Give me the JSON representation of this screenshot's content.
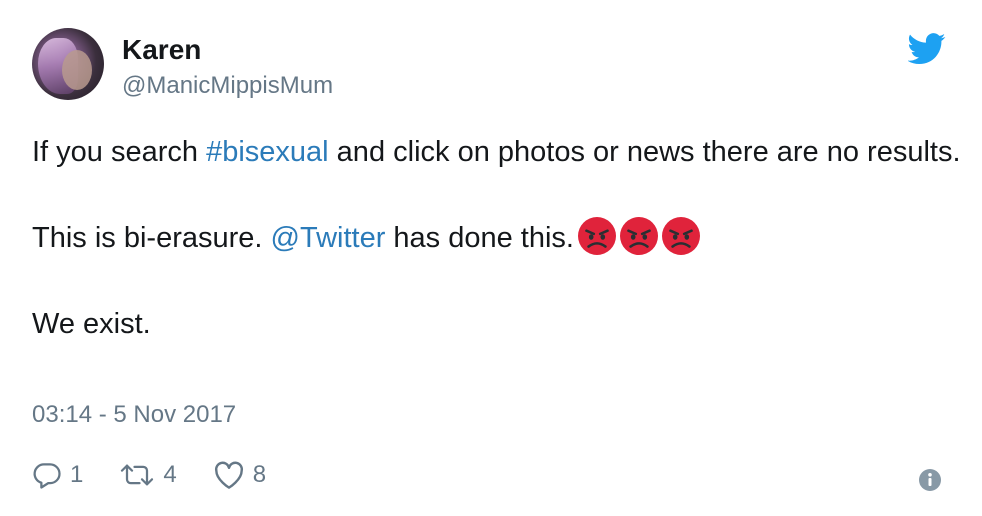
{
  "author": {
    "display_name": "Karen",
    "handle": "@ManicMippisMum",
    "avatar_icon": "profile-photo"
  },
  "brand_icon": "twitter-bird-icon",
  "tweet": {
    "line1_before": "If you search ",
    "hashtag": "#bisexual",
    "line1_after": " and click on photos or news there are no results.",
    "line2_before": "This is bi-erasure. ",
    "mention": "@Twitter",
    "line2_after": " has done this.",
    "emojis": [
      "angry-face-emoji",
      "angry-face-emoji",
      "angry-face-emoji"
    ],
    "line3": "We exist."
  },
  "timestamp": "03:14 - 5 Nov 2017",
  "actions": {
    "reply_count": "1",
    "retweet_count": "4",
    "like_count": "8"
  },
  "colors": {
    "link": "#2b7bb9",
    "secondary_text": "#657786",
    "brand_blue": "#1da1f2",
    "emoji_red": "#e0233b"
  }
}
